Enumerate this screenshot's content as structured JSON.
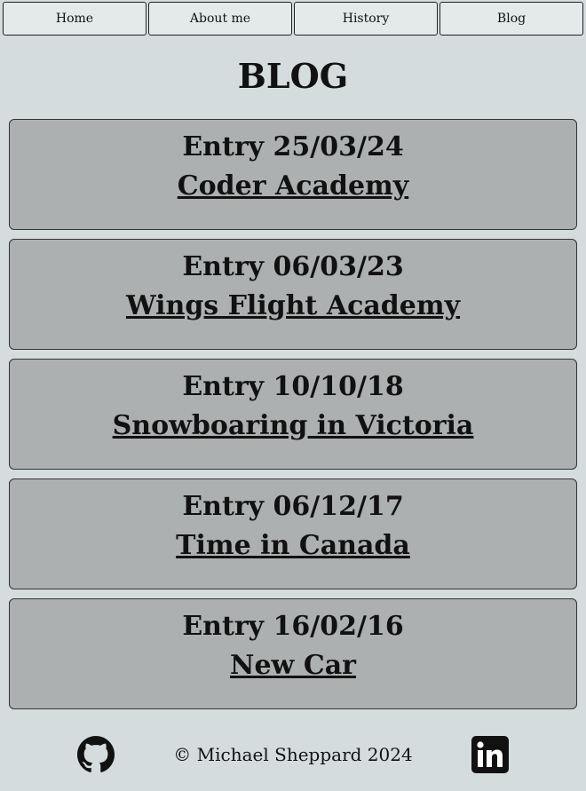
{
  "nav": {
    "items": [
      {
        "label": "Home"
      },
      {
        "label": "About me"
      },
      {
        "label": "History"
      },
      {
        "label": "Blog"
      }
    ]
  },
  "page": {
    "title": "BLOG"
  },
  "entries": [
    {
      "date": "Entry 25/03/24",
      "title": "Coder Academy"
    },
    {
      "date": "Entry 06/03/23",
      "title": "Wings Flight Academy"
    },
    {
      "date": "Entry 10/10/18",
      "title": "Snowboaring in Victoria"
    },
    {
      "date": "Entry 06/12/17",
      "title": "Time in Canada"
    },
    {
      "date": "Entry 16/02/16",
      "title": "New Car"
    }
  ],
  "footer": {
    "copyright": "© Michael Sheppard 2024",
    "icons": [
      "github-icon",
      "linkedin-icon"
    ]
  }
}
